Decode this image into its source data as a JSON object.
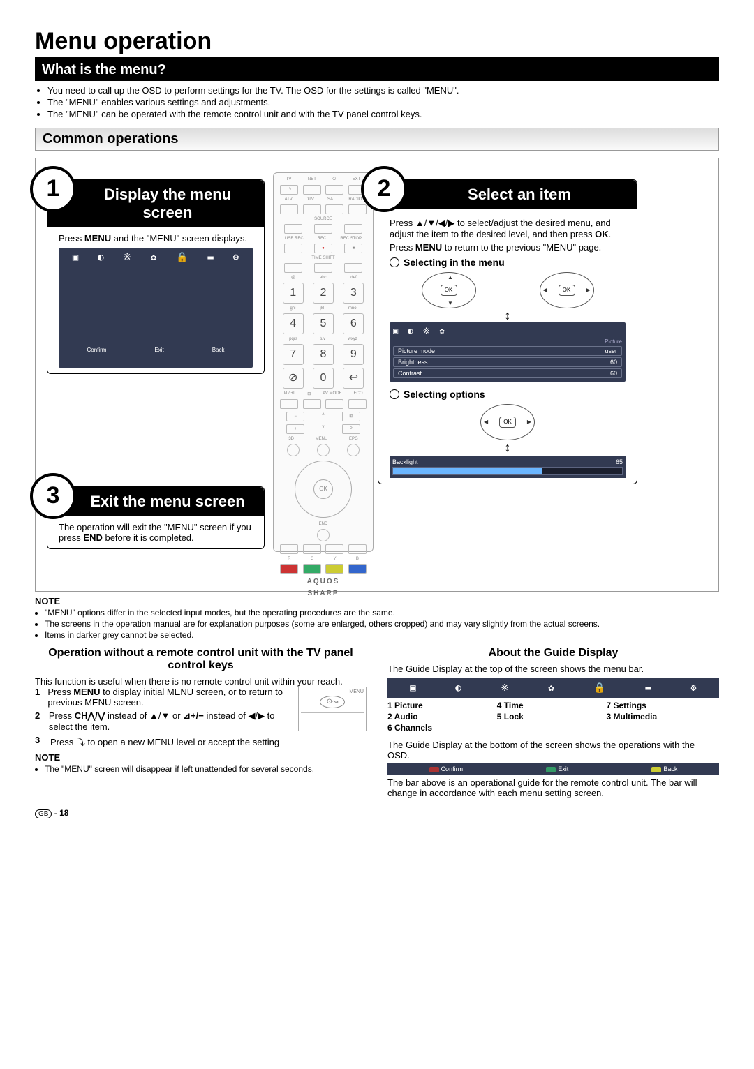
{
  "title": "Menu operation",
  "section1": {
    "heading": "What is the menu?",
    "bullets": [
      "You need to call up the OSD to perform settings for the TV. The OSD for the settings is called \"MENU\".",
      "The \"MENU\" enables various settings and adjustments.",
      "The \"MENU\" can be operated with the remote control unit and with the TV panel control keys."
    ]
  },
  "section2": {
    "heading": "Common operations"
  },
  "step1": {
    "num": "1",
    "title": "Display the menu screen",
    "body_pre": "Press ",
    "body_bold": "MENU",
    "body_post": " and the \"MENU\" screen displays.",
    "osd_bottom": [
      "Confirm",
      "Exit",
      "Back"
    ]
  },
  "step2": {
    "num": "2",
    "title": "Select an item",
    "body1_pre": "Press ▲/▼/◀/▶ to select/adjust the desired menu, and adjust the item to the desired level, and then press ",
    "body1_bold": "OK",
    "body1_post": ".",
    "body2_pre": "Press ",
    "body2_bold": "MENU",
    "body2_post": " to return to the previous \"MENU\" page.",
    "sub1": "Selecting in the menu",
    "sub2": "Selecting options",
    "osd_rows": [
      {
        "label": "Picture mode",
        "val": "user"
      },
      {
        "label": "Brightness",
        "val": "60"
      },
      {
        "label": "Contrast",
        "val": "60"
      }
    ],
    "osd_section": "Picture",
    "backlight_label": "Backlight",
    "backlight_val": "65"
  },
  "step3": {
    "num": "3",
    "title": "Exit the menu screen",
    "body_pre": "The operation will exit the \"MENU\" screen if you press ",
    "body_bold": "END",
    "body_post": " before it is completed."
  },
  "remote": {
    "top_labels": [
      "TV",
      "NET",
      "⏻",
      "EXT"
    ],
    "row2": [
      "ATV",
      "DTV",
      "SAT",
      "RADIO"
    ],
    "source": "SOURCE",
    "row3": [
      "USB REC",
      "REC",
      "REC STOP"
    ],
    "timeshift": "TIME SHIFT",
    "keypad": [
      "1",
      "2",
      "3",
      "4",
      "5",
      "6",
      "7",
      "8",
      "9",
      "0"
    ],
    "sublabels": [
      ".@",
      "abc",
      "def",
      "ghi",
      "jkl",
      "mno",
      "pqrs",
      "tuv",
      "wxyz"
    ],
    "row_modes": [
      "I/II/I+II",
      "⊞",
      "AV MODE",
      "ECO"
    ],
    "round_row": [
      "3D",
      "MENU",
      "EPG"
    ],
    "ok": "OK",
    "end": "END",
    "brand1": "AQUOS",
    "brand2": "SHARP"
  },
  "note1": {
    "label": "NOTE",
    "items": [
      "\"MENU\" options differ in the selected input modes, but the operating procedures are the same.",
      "The screens in the operation manual are for explanation purposes (some are enlarged, others cropped) and may vary slightly from the actual screens.",
      "Items in darker grey cannot be selected."
    ]
  },
  "left_col": {
    "heading": "Operation without a remote control unit with the TV panel control keys",
    "intro": "This function is useful when there is no remote control unit within your reach.",
    "panel_label": "MENU",
    "s1_pre": "Press ",
    "s1_bold": "MENU",
    "s1_post": " to display initial MENU screen, or to return to previous MENU screen.",
    "s2_pre": "Press ",
    "s2_bold": "CH⋀/⋁",
    "s2_mid": " instead of ▲/▼ or ",
    "s2_bold2": "⊿+/−",
    "s2_post": " instead of ◀/▶ to select the item.",
    "s3": "Press ⤵ to open a new MENU level or accept the setting",
    "note_label": "NOTE",
    "note_item": "The \"MENU\" screen will disappear if left unattended for several seconds."
  },
  "right_col": {
    "heading": "About the Guide Display",
    "p1": "The Guide Display at the top of the screen shows the menu bar.",
    "guide_items": [
      "1 Picture",
      "4 Time",
      "7 Settings",
      "2 Audio",
      "5 Lock",
      "3 Multimedia",
      "6 Channels"
    ],
    "p2": "The Guide Display at the bottom of the screen shows the operations with the OSD.",
    "ops": [
      "Confirm",
      "Exit",
      "Back"
    ],
    "p3": "The bar above is an operational guide for the remote control unit. The bar will change in accordance with each menu setting screen."
  },
  "footer": {
    "region": "GB",
    "sep": " - ",
    "page": "18"
  }
}
